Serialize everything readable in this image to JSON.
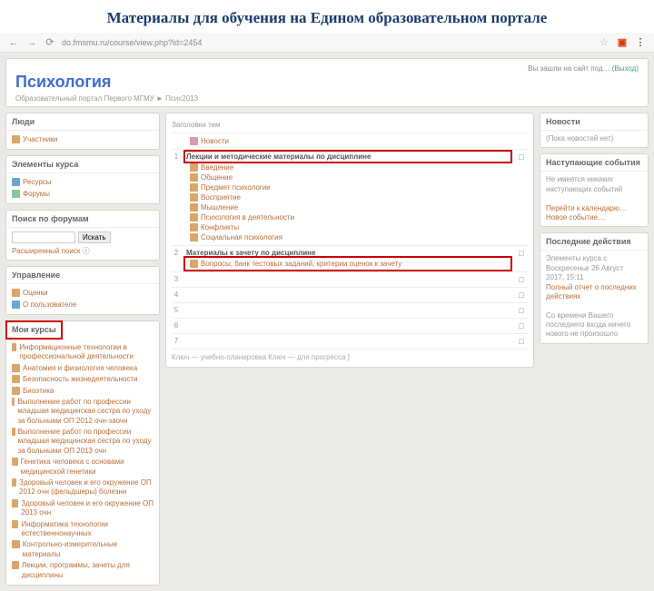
{
  "slide_title": "Материалы для обучения на Едином образовательном портале",
  "browser": {
    "url": "do.fmsmu.ru/course/view.php?id=2454"
  },
  "header": {
    "title": "Психология",
    "top_left": "Вы зашли на сайт под…",
    "login_link": "(Выход)",
    "breadcrumb": "Образовательный портал Первого МГМУ ► Псих2013"
  },
  "left": {
    "people": {
      "title": "Люди",
      "items": [
        "Участники"
      ]
    },
    "elements": {
      "title": "Элементы курса",
      "items": [
        "Ресурсы",
        "Форумы"
      ]
    },
    "search": {
      "title": "Поиск по форумам",
      "button": "Искать",
      "placeholder": "",
      "adv": "Расширенный поиск"
    },
    "admin": {
      "title": "Управление",
      "items": [
        "Оценки",
        "О пользователе"
      ]
    },
    "mycourses": {
      "title": "Мои курсы",
      "items": [
        "Информационные технологии в профессиональной деятельности",
        "Анатомия и физиология человека",
        "Безопасность жизнедеятельности",
        "Биоэтика",
        "Выполнение работ по профессии младшая медицинская сестра по уходу за больными ОП 2012 очн-заочн",
        "Выполнение работ по профессии младшая медицинская сестра по уходу за больными ОП 2013 очн",
        "Генетика человека с основами медицинской генетики",
        "Здоровый человек и его окружение ОП 2012 очн (фельдшеры) болезни",
        "Здоровый человек и его окружение ОП 2013 очн",
        "Информатика технологии естественнонаучных",
        "Контрольно-измерительные материалы",
        "Лекции, программы, зачеты для дисциплины"
      ]
    }
  },
  "center": {
    "head_left": "Заголовки тем",
    "top_item": "Новости",
    "topics": [
      {
        "num": "1",
        "title": "Лекции и методические материалы по дисциплине",
        "highlight_title": true,
        "items": [
          "Введение",
          "Общение",
          "Предмет психологии",
          "Восприятие",
          "Мышление",
          "Психология в деятельности",
          "Конфликты",
          "Социальная психология"
        ]
      },
      {
        "num": "2",
        "title": "Материалы к зачету по дисциплине",
        "highlight_row": true,
        "items": [
          "Вопросы, банк тестовых заданий, критерии оценок к зачету"
        ]
      },
      {
        "num": "3",
        "title": "",
        "items": []
      },
      {
        "num": "4",
        "title": "",
        "items": []
      },
      {
        "num": "5",
        "title": "",
        "items": []
      },
      {
        "num": "6",
        "title": "",
        "items": []
      },
      {
        "num": "7",
        "title": "",
        "items": []
      }
    ],
    "key": "Ключ — учебно-планировка Ключ — для прогресса ]"
  },
  "right": {
    "news": {
      "title": "Новости",
      "body": "(Пока новостей нет)"
    },
    "events": {
      "title": "Наступающие события",
      "body": "Не имеется никаких наступающих событий",
      "links": [
        "Перейти к календарю…",
        "Новое событие…"
      ]
    },
    "recent": {
      "title": "Последние действия",
      "body": "Элементы курса с Воскресенье 26 Август 2017, 15:11",
      "link": "Полный отчет о последних действиях",
      "footer": "Со времени Вашего последнего входа ничего нового не произошло"
    }
  }
}
